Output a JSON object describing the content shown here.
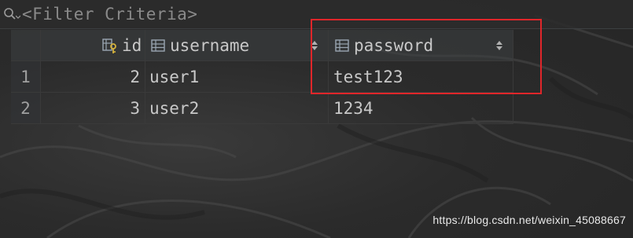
{
  "filter": {
    "placeholder": "<Filter Criteria>"
  },
  "table": {
    "columns": [
      {
        "label": "id",
        "icon": "key-column-icon"
      },
      {
        "label": "username",
        "icon": "column-icon"
      },
      {
        "label": "password",
        "icon": "column-icon"
      }
    ],
    "rows": [
      {
        "num": "1",
        "id": "2",
        "username": "user1",
        "password": "test123"
      },
      {
        "num": "2",
        "id": "3",
        "username": "user2",
        "password": "1234"
      }
    ]
  },
  "annotation": {
    "color": "#e0262a"
  },
  "watermark": "https://blog.csdn.net/weixin_45088667"
}
